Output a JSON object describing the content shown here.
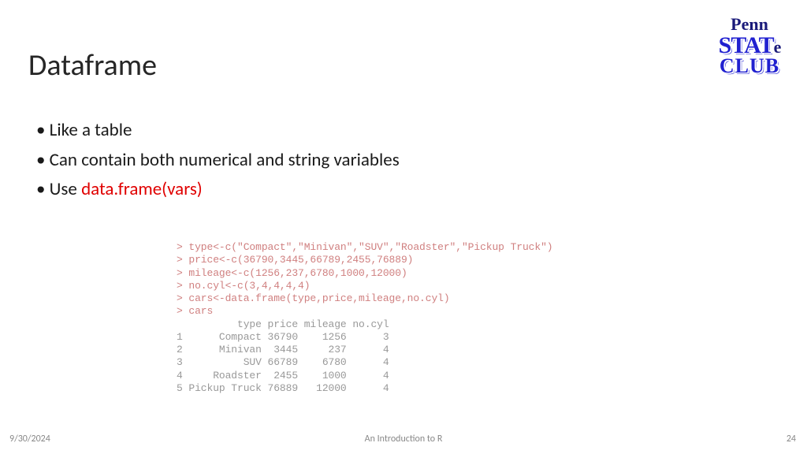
{
  "title": "Dataframe",
  "logo": {
    "line1": "Penn",
    "line2a": "STAT",
    "line2b": "e",
    "line3": "CLUB"
  },
  "bullets": {
    "b1": "Like a table",
    "b2": "Can contain both numerical and string variables",
    "b3a": "Use ",
    "b3b": "data.frame(vars)"
  },
  "code": {
    "l1": "> type<-c(\"Compact\",\"Minivan\",\"SUV\",\"Roadster\",\"Pickup Truck\")",
    "l2": "> price<-c(36790,3445,66789,2455,76889)",
    "l3": "> mileage<-c(1256,237,6780,1000,12000)",
    "l4": "> no.cyl<-c(3,4,4,4,4)",
    "l5": "> cars<-data.frame(type,price,mileage,no.cyl)",
    "l6": "> cars",
    "l7": "          type price mileage no.cyl",
    "l8": "1      Compact 36790    1256      3",
    "l9": "2      Minivan  3445     237      4",
    "l10": "3          SUV 66789    6780      4",
    "l11": "4     Roadster  2455    1000      4",
    "l12": "5 Pickup Truck 76889   12000      4"
  },
  "footer": {
    "date": "9/30/2024",
    "title": "An Introduction to R",
    "page": "24"
  }
}
